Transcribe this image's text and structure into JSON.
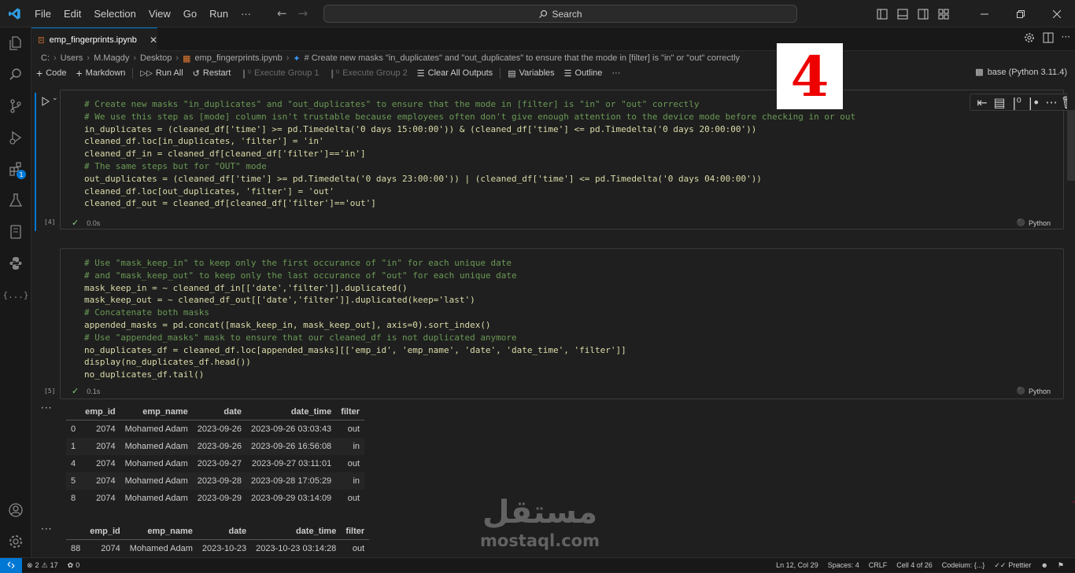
{
  "menu": [
    "File",
    "Edit",
    "Selection",
    "View",
    "Go",
    "Run",
    "···"
  ],
  "search": {
    "label": "Search"
  },
  "tab": {
    "title": "emp_fingerprints.ipynb"
  },
  "breadcrumb": [
    "C:",
    "Users",
    "M.Magdy",
    "Desktop",
    "emp_fingerprints.ipynb",
    "# Create new masks \"in_duplicates\" and \"out_duplicates\" to ensure that the mode in [filter] is \"in\" or \"out\" correctly"
  ],
  "toolbar": {
    "code": "Code",
    "markdown": "Markdown",
    "run_all": "Run All",
    "restart": "Restart",
    "exec_group1": "Execute Group 1",
    "exec_group2": "Execute Group 2",
    "clear_outputs": "Clear All Outputs",
    "variables": "Variables",
    "outline": "Outline",
    "more": "···",
    "kernel": "base (Python 3.11.4)"
  },
  "cells": [
    {
      "exec_count": "[4]",
      "time": "0.0s",
      "language": "Python",
      "lines": [
        {
          "type": "comment",
          "text": "# Create new masks \"in_duplicates\" and \"out_duplicates\" to ensure that the mode in [filter] is \"in\" or \"out\" correctly"
        },
        {
          "type": "comment",
          "text": "# We use this step as [mode] column isn't trustable because employees often don't give enough attention to the device mode before checking in or out"
        },
        {
          "type": "code",
          "text": "in_duplicates = (cleaned_df['time'] >= pd.Timedelta('0 days 15:00:00')) & (cleaned_df['time'] <= pd.Timedelta('0 days 20:00:00'))"
        },
        {
          "type": "code",
          "text": "cleaned_df.loc[in_duplicates, 'filter'] = 'in'"
        },
        {
          "type": "code",
          "text": "cleaned_df_in = cleaned_df[cleaned_df['filter']=='in']"
        },
        {
          "type": "comment",
          "text": "# The same steps but for \"OUT\" mode"
        },
        {
          "type": "code",
          "text": "out_duplicates = (cleaned_df['time'] >= pd.Timedelta('0 days 23:00:00')) | (cleaned_df['time'] <= pd.Timedelta('0 days 04:00:00'))"
        },
        {
          "type": "code",
          "text": "cleaned_df.loc[out_duplicates, 'filter'] = 'out'"
        },
        {
          "type": "code",
          "text": "cleaned_df_out = cleaned_df[cleaned_df['filter']=='out']"
        }
      ]
    },
    {
      "exec_count": "[5]",
      "time": "0.1s",
      "language": "Python",
      "lines": [
        {
          "type": "comment",
          "text": "# Use \"mask_keep_in\" to keep only the first occurance of \"in\" for each unique date"
        },
        {
          "type": "comment",
          "text": "# and \"mask_keep_out\" to keep only the last occurance of \"out\" for each unique date"
        },
        {
          "type": "code",
          "text": "mask_keep_in = ~ cleaned_df_in[['date','filter']].duplicated()"
        },
        {
          "type": "code",
          "text": "mask_keep_out = ~ cleaned_df_out[['date','filter']].duplicated(keep='last')"
        },
        {
          "type": "comment",
          "text": "# Concatenate both masks"
        },
        {
          "type": "code",
          "text": "appended_masks = pd.concat([mask_keep_in, mask_keep_out], axis=0).sort_index()"
        },
        {
          "type": "comment",
          "text": "# Use \"appended_masks\" mask to ensure that our cleaned_df is not duplicated anymore"
        },
        {
          "type": "code",
          "text": "no_duplicates_df = cleaned_df.loc[appended_masks][['emp_id', 'emp_name', 'date', 'date_time', 'filter']]"
        },
        {
          "type": "code",
          "text": "display(no_duplicates_df.head())"
        },
        {
          "type": "code",
          "text": "no_duplicates_df.tail()"
        }
      ]
    }
  ],
  "output1": {
    "columns": [
      "",
      "emp_id",
      "emp_name",
      "date",
      "date_time",
      "filter"
    ],
    "rows": [
      [
        "0",
        "2074",
        "Mohamed Adam",
        "2023-09-26",
        "2023-09-26 03:03:43",
        "out"
      ],
      [
        "1",
        "2074",
        "Mohamed Adam",
        "2023-09-26",
        "2023-09-26 16:56:08",
        "in"
      ],
      [
        "4",
        "2074",
        "Mohamed Adam",
        "2023-09-27",
        "2023-09-27 03:11:01",
        "out"
      ],
      [
        "5",
        "2074",
        "Mohamed Adam",
        "2023-09-28",
        "2023-09-28 17:05:29",
        "in"
      ],
      [
        "8",
        "2074",
        "Mohamed Adam",
        "2023-09-29",
        "2023-09-29 03:14:09",
        "out"
      ]
    ]
  },
  "output2": {
    "columns": [
      "",
      "emp_id",
      "emp_name",
      "date",
      "date_time",
      "filter"
    ],
    "rows": [
      [
        "88",
        "2074",
        "Mohamed Adam",
        "2023-10-23",
        "2023-10-23 03:14:28",
        "out"
      ]
    ]
  },
  "overlay": {
    "number": "4",
    "watermark_ar": "مستقل",
    "watermark_lat": "mostaql.com"
  },
  "status": {
    "errors": "2",
    "warnings": "17",
    "ports": "0",
    "position": "Ln 12, Col 29",
    "spaces": "Spaces: 4",
    "eol": "CRLF",
    "cell": "Cell 4 of 26",
    "codeium": "Codeium: {...}",
    "prettier": "Prettier"
  }
}
